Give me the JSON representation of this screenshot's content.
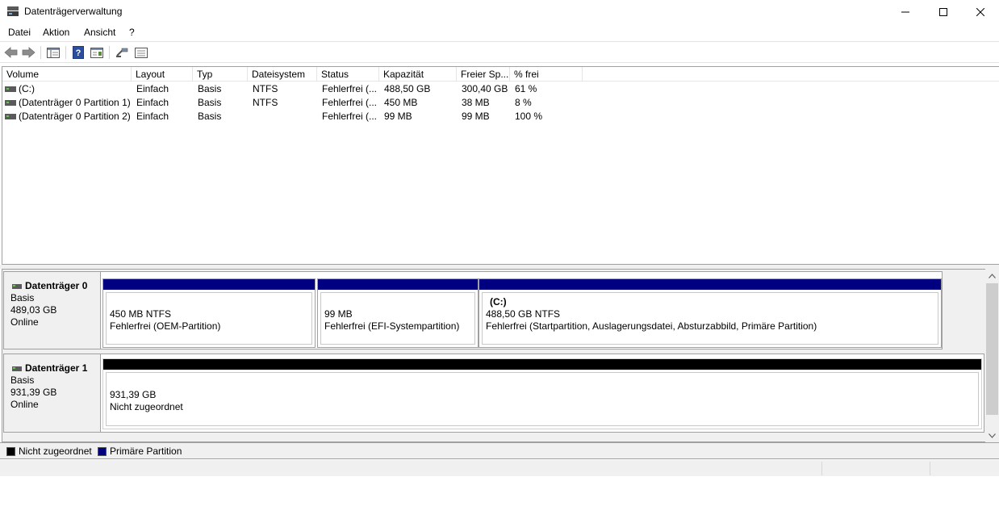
{
  "window": {
    "title": "Datenträgerverwaltung",
    "minimize_icon": "minimize-icon",
    "maximize_icon": "maximize-icon",
    "close_icon": "close-icon"
  },
  "menu": [
    "Datei",
    "Aktion",
    "Ansicht",
    "?"
  ],
  "toolbar": {
    "icons": [
      "back-arrow-icon",
      "forward-arrow-icon",
      "console-tree-icon",
      "help-icon",
      "properties-icon",
      "connect-icon",
      "list-view-icon"
    ]
  },
  "volume_list": {
    "columns": [
      "Volume",
      "Layout",
      "Typ",
      "Dateisystem",
      "Status",
      "Kapazität",
      "Freier Sp...",
      "% frei"
    ],
    "rows": [
      {
        "volume": " (C:)",
        "layout": "Einfach",
        "typ": "Basis",
        "dateisystem": "NTFS",
        "status": "Fehlerfrei (...",
        "kapazitaet": "488,50 GB",
        "frei": "300,40 GB",
        "prozent": "61 %"
      },
      {
        "volume": "(Datenträger 0 Partition 1)",
        "layout": "Einfach",
        "typ": "Basis",
        "dateisystem": "NTFS",
        "status": "Fehlerfrei (...",
        "kapazitaet": "450 MB",
        "frei": "38 MB",
        "prozent": "8 %"
      },
      {
        "volume": "(Datenträger 0 Partition 2)",
        "layout": "Einfach",
        "typ": "Basis",
        "dateisystem": "",
        "status": "Fehlerfrei (...",
        "kapazitaet": "99 MB",
        "frei": "99 MB",
        "prozent": "100 %"
      }
    ]
  },
  "disks": [
    {
      "name": "Datenträger 0",
      "type": "Basis",
      "size": "489,03 GB",
      "state": "Online",
      "partitions": [
        {
          "title": "",
          "line1": "450 MB NTFS",
          "line2": "Fehlerfrei (OEM-Partition)"
        },
        {
          "title": "",
          "line1": "99 MB",
          "line2": "Fehlerfrei (EFI-Systempartition)"
        },
        {
          "title": "(C:)",
          "line1": "488,50 GB NTFS",
          "line2": "Fehlerfrei (Startpartition, Auslagerungsdatei, Absturzabbild, Primäre Partition)"
        }
      ]
    },
    {
      "name": "Datenträger 1",
      "type": "Basis",
      "size": "931,39 GB",
      "state": "Online",
      "partitions": [
        {
          "title": "",
          "line1": "931,39 GB",
          "line2": "Nicht zugeordnet"
        }
      ]
    }
  ],
  "legend": [
    {
      "label": "Nicht zugeordnet",
      "color": "#000000"
    },
    {
      "label": "Primäre Partition",
      "color": "#000080"
    }
  ],
  "colors": {
    "primary_partition": "#000080",
    "unallocated": "#000000"
  }
}
